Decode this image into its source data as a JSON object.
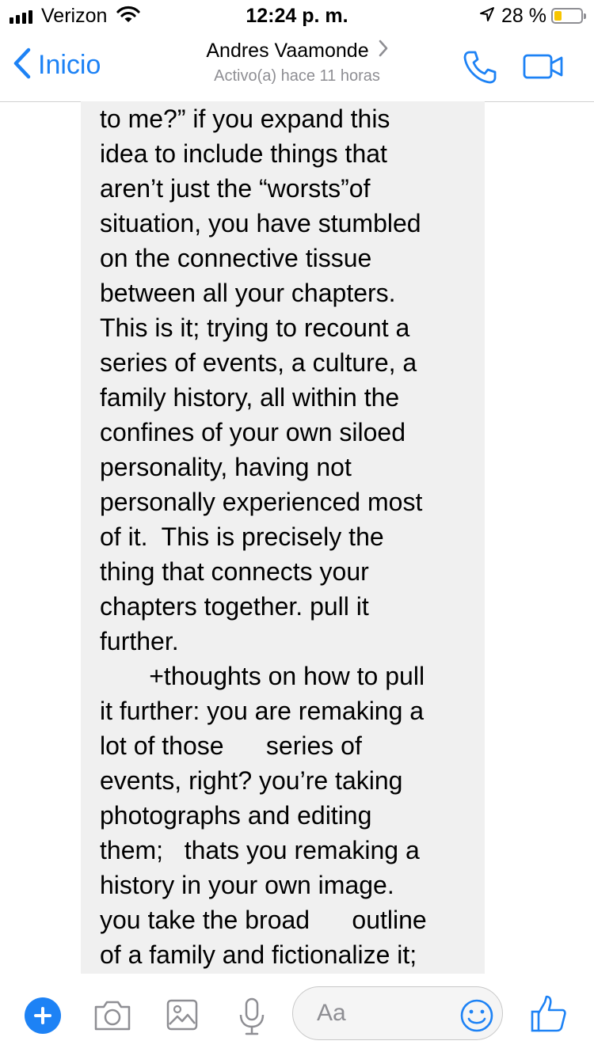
{
  "status_bar": {
    "carrier": "Verizon",
    "time": "12:24 p. m.",
    "battery_percent": "28 %",
    "battery_level": 0.28
  },
  "nav": {
    "back_label": "Inicio",
    "contact_name": "Andres Vaamonde",
    "presence": "Activo(a) hace 11 horas"
  },
  "message": {
    "lines": [
      "to me?” if you expand this",
      "idea to include things that",
      "aren’t just the “worsts”of",
      "situation, you have stumbled",
      "on the connective tissue",
      "between all your chapters.",
      "This is it; trying to recount a",
      "series of events, a culture, a",
      "family history, all within the",
      "confines of your own siloed",
      "personality, having not",
      "personally experienced most",
      "of it.  This is precisely the",
      "thing that connects your",
      "chapters together. pull it",
      "further.",
      "       +thoughts on how to pull",
      "it further: you are remaking a",
      "lot of those      series of",
      "events, right? you’re taking",
      "photographs and editing",
      "them;   thats you remaking a",
      "history in your own image.",
      "you take the broad      outline",
      "of a family and fictionalize it;"
    ]
  },
  "composer": {
    "placeholder": "Aa"
  },
  "colors": {
    "accent": "#1d82f5",
    "bubble": "#f0f0f0",
    "battery_fill": "#f7c500"
  }
}
